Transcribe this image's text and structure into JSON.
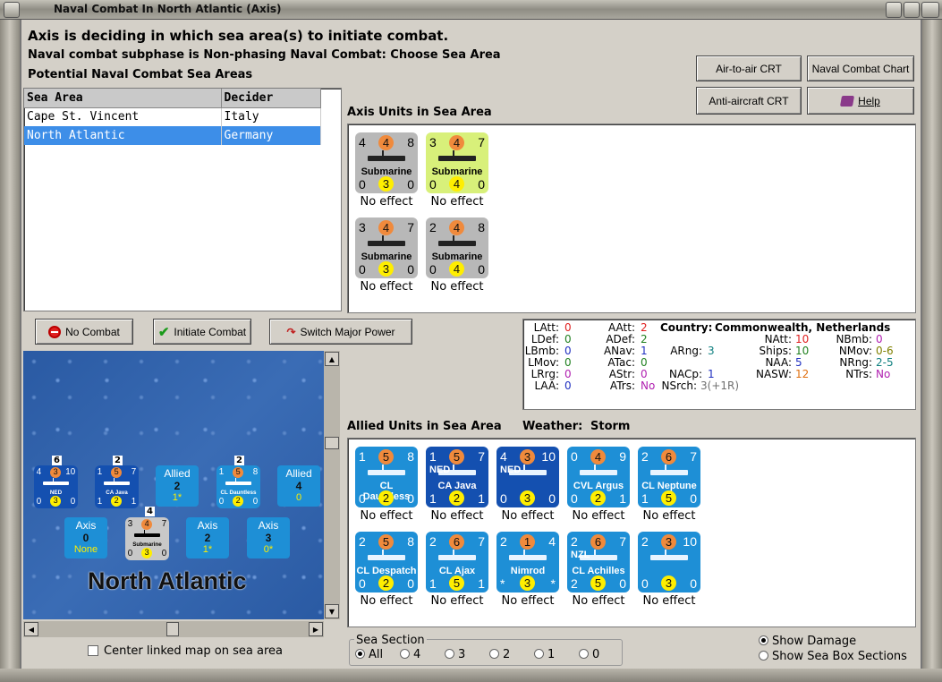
{
  "window": {
    "title": "Naval Combat In North Atlantic (Axis)"
  },
  "header": {
    "line1": "Axis is deciding in which sea area(s) to initiate combat.",
    "line2": "Naval combat subphase is Non-phasing Naval Combat: Choose Sea Area",
    "line3": "Potential Naval Combat Sea Areas"
  },
  "buttons": {
    "air_to_air": "Air-to-air CRT",
    "naval_chart": "Naval Combat Chart",
    "anti_aircraft": "Anti-aircraft CRT",
    "help": "Help",
    "no_combat": "No Combat",
    "initiate": "Initiate Combat",
    "switch": "Switch Major Power"
  },
  "sea_table": {
    "headers": [
      "Sea Area",
      "Decider"
    ],
    "rows": [
      {
        "area": "Cape St. Vincent",
        "decider": "Italy"
      },
      {
        "area": "North Atlantic",
        "decider": "Germany"
      }
    ]
  },
  "axis_units": {
    "label": "Axis Units in Sea Area",
    "units": [
      {
        "tl": "4",
        "tc": "4",
        "tr": "8",
        "name": "Submarine",
        "bl": "0",
        "bc": "3",
        "br": "0",
        "status": "No effect",
        "bg": "#b8b8b8"
      },
      {
        "tl": "3",
        "tc": "4",
        "tr": "7",
        "name": "Submarine",
        "bl": "0",
        "bc": "4",
        "br": "0",
        "status": "No effect",
        "bg": "#d8f07a"
      },
      {
        "tl": "3",
        "tc": "4",
        "tr": "7",
        "name": "Submarine",
        "bl": "0",
        "bc": "3",
        "br": "0",
        "status": "No effect",
        "bg": "#b8b8b8"
      },
      {
        "tl": "2",
        "tc": "4",
        "tr": "8",
        "name": "Submarine",
        "bl": "0",
        "bc": "4",
        "br": "0",
        "status": "No effect",
        "bg": "#b8b8b8"
      }
    ]
  },
  "stats": {
    "country_label": "Country:",
    "country": "Commonwealth, Netherlands",
    "col1": [
      [
        "LAtt:",
        "0"
      ],
      [
        "LDef:",
        "0"
      ],
      [
        "LBmb:",
        "0"
      ],
      [
        "LMov:",
        "0"
      ],
      [
        "LRrg:",
        "0"
      ],
      [
        "LAA:",
        "0"
      ]
    ],
    "col2": [
      [
        "AAtt:",
        "2"
      ],
      [
        "ADef:",
        "2"
      ],
      [
        "ANav:",
        "1"
      ],
      [
        "ATac:",
        "0"
      ],
      [
        "AStr:",
        "0"
      ],
      [
        "ATrs:",
        "No"
      ]
    ],
    "col3": [
      [
        "ARng:",
        "3"
      ],
      [
        "NACp:",
        "1"
      ],
      [
        "NSrch:",
        "3(+1R)"
      ]
    ],
    "col4": [
      [
        "NAtt:",
        "10"
      ],
      [
        "Ships:",
        "10"
      ],
      [
        "NAA:",
        "5"
      ],
      [
        "NASW:",
        "12"
      ]
    ],
    "col5": [
      [
        "NBmb:",
        "0"
      ],
      [
        "NMov:",
        "0-6"
      ],
      [
        "NRng:",
        "2-5"
      ],
      [
        "NTrs:",
        "No"
      ]
    ],
    "colors": {
      "red": "#e02020",
      "green": "#208020",
      "blue": "#2030c0",
      "teal": "#108080",
      "orange": "#e07010",
      "purple": "#b020b0",
      "olive": "#808000",
      "gray": "#707070"
    }
  },
  "allied_units": {
    "label": "Allied Units in Sea Area",
    "weather_label": "Weather:",
    "weather": "Storm",
    "units": [
      {
        "tl": "1",
        "tc": "5",
        "tr": "8",
        "name": "CL Dauntless",
        "bl": "0",
        "bc": "2",
        "br": "0",
        "status": "No effect",
        "bg": "#1e8fd6",
        "flag": ""
      },
      {
        "tl": "1",
        "tc": "5",
        "tr": "7",
        "name": "CA Java",
        "bl": "1",
        "bc": "2",
        "br": "1",
        "status": "No effect",
        "bg": "#1450b0",
        "flag": "NED"
      },
      {
        "tl": "4",
        "tc": "3",
        "tr": "10",
        "name": "",
        "bl": "0",
        "bc": "3",
        "br": "0",
        "status": "No effect",
        "bg": "#1450b0",
        "flag": "NED"
      },
      {
        "tl": "0",
        "tc": "4",
        "tr": "9",
        "name": "CVL Argus",
        "bl": "0",
        "bc": "2",
        "br": "1",
        "status": "No effect",
        "bg": "#1e8fd6",
        "flag": ""
      },
      {
        "tl": "2",
        "tc": "6",
        "tr": "7",
        "name": "CL Neptune",
        "bl": "1",
        "bc": "5",
        "br": "0",
        "status": "No effect",
        "bg": "#1e8fd6",
        "flag": ""
      },
      {
        "tl": "2",
        "tc": "5",
        "tr": "8",
        "name": "CL Despatch",
        "bl": "0",
        "bc": "2",
        "br": "0",
        "status": "No effect",
        "bg": "#1e8fd6",
        "flag": ""
      },
      {
        "tl": "2",
        "tc": "6",
        "tr": "7",
        "name": "CL Ajax",
        "bl": "1",
        "bc": "5",
        "br": "1",
        "status": "No effect",
        "bg": "#1e8fd6",
        "flag": ""
      },
      {
        "tl": "2",
        "tc": "1",
        "tr": "4",
        "name": "Nimrod",
        "bl": "*",
        "bc": "3",
        "br": "*",
        "status": "No effect",
        "bg": "#1e8fd6",
        "flag": ""
      },
      {
        "tl": "2",
        "tc": "6",
        "tr": "7",
        "name": "CL Achilles",
        "bl": "2",
        "bc": "5",
        "br": "0",
        "status": "No effect",
        "bg": "#1e8fd6",
        "flag": "NZL"
      },
      {
        "tl": "2",
        "tc": "3",
        "tr": "10",
        "name": "",
        "bl": "0",
        "bc": "3",
        "br": "0",
        "status": "No effect",
        "bg": "#1e8fd6",
        "flag": ""
      }
    ]
  },
  "map": {
    "sea_name": "North Atlantic",
    "boxes": [
      {
        "title": "Allied",
        "v1": "2",
        "v2": "1*"
      },
      {
        "title": "Allied",
        "v1": "4",
        "v2": "0"
      },
      {
        "title": "Axis",
        "v1": "0",
        "v2": "None"
      },
      {
        "title": "Axis",
        "v1": "2",
        "v2": "1*"
      },
      {
        "title": "Axis",
        "v1": "3",
        "v2": "0*"
      }
    ],
    "stack_counts": [
      "6",
      "2",
      "2",
      "4"
    ],
    "mini_units": [
      {
        "tl": "4",
        "tc": "3",
        "tr": "10",
        "name": "NED",
        "bl": "0",
        "bc": "3",
        "br": "0"
      },
      {
        "tl": "1",
        "tc": "5",
        "tr": "7",
        "name": "CA Java",
        "bl": "1",
        "bc": "2",
        "br": "1"
      },
      {
        "tl": "1",
        "tc": "5",
        "tr": "8",
        "name": "CL Dauntless",
        "bl": "0",
        "bc": "2",
        "br": "0"
      },
      {
        "tl": "3",
        "tc": "4",
        "tr": "7",
        "name": "Submarine",
        "bl": "0",
        "bc": "3",
        "br": "0"
      }
    ]
  },
  "options": {
    "center_map": "Center linked map on sea area",
    "sea_section_label": "Sea Section",
    "sections": [
      "All",
      "4",
      "3",
      "2",
      "1",
      "0"
    ],
    "show_damage": "Show Damage",
    "show_boxes": "Show Sea Box Sections"
  }
}
